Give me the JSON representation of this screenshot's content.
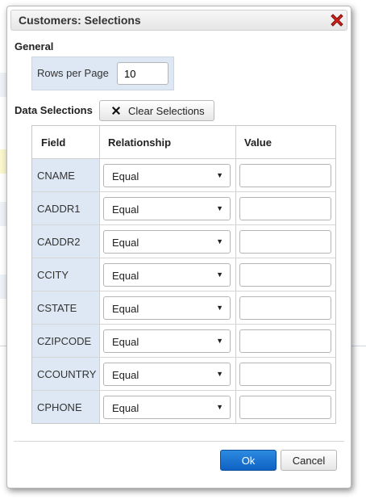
{
  "dialog": {
    "title": "Customers: Selections",
    "close_icon": "close-icon"
  },
  "general": {
    "heading": "General",
    "rows_per_page_label": "Rows per Page",
    "rows_per_page_value": "10"
  },
  "data_selections": {
    "heading": "Data Selections",
    "clear_button_label": "Clear Selections",
    "clear_icon": "x-icon"
  },
  "grid": {
    "headers": {
      "field": "Field",
      "relationship": "Relationship",
      "value": "Value"
    },
    "rows": [
      {
        "field": "CNAME",
        "relationship": "Equal",
        "value": ""
      },
      {
        "field": "CADDR1",
        "relationship": "Equal",
        "value": ""
      },
      {
        "field": "CADDR2",
        "relationship": "Equal",
        "value": ""
      },
      {
        "field": "CCITY",
        "relationship": "Equal",
        "value": ""
      },
      {
        "field": "CSTATE",
        "relationship": "Equal",
        "value": ""
      },
      {
        "field": "CZIPCODE",
        "relationship": "Equal",
        "value": ""
      },
      {
        "field": "CCOUNTRY",
        "relationship": "Equal",
        "value": ""
      },
      {
        "field": "CPHONE",
        "relationship": "Equal",
        "value": ""
      }
    ]
  },
  "footer": {
    "ok_label": "Ok",
    "cancel_label": "Cancel"
  },
  "colors": {
    "primary_button": "#1a6fd0",
    "label_bg": "#dde8f4",
    "close_red": "#d9221c"
  }
}
